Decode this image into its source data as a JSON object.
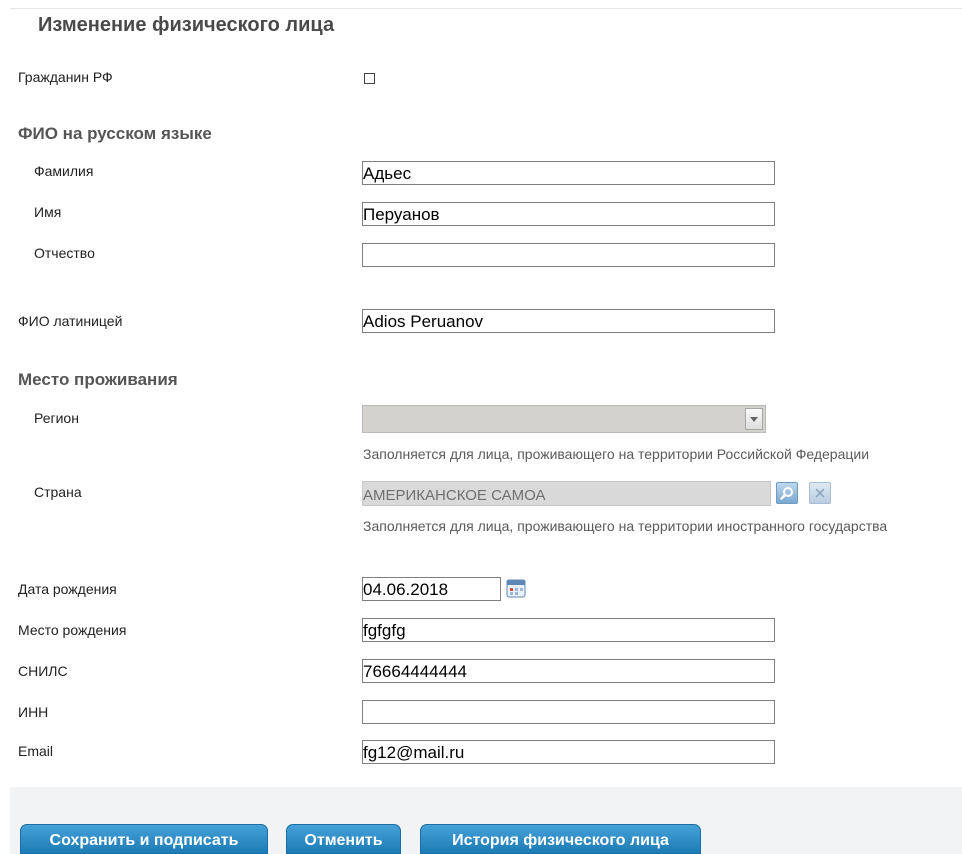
{
  "page": {
    "title": "Изменение физического лица"
  },
  "citizen": {
    "label": "Гражданин РФ",
    "checked": false
  },
  "fio_ru": {
    "section": "ФИО на русском языке",
    "surname": {
      "label": "Фамилия",
      "value": "Адьес"
    },
    "name": {
      "label": "Имя",
      "value": "Перуанов"
    },
    "patronymic": {
      "label": "Отчество",
      "value": ""
    }
  },
  "fio_lat": {
    "label": "ФИО латиницей",
    "value": "Adios Peruanov"
  },
  "residence": {
    "section": "Место проживания",
    "region": {
      "label": "Регион",
      "value": "",
      "hint": "Заполняется для лица, проживающего на территории Российской Федерации"
    },
    "country": {
      "label": "Страна",
      "value": "АМЕРИКАНСКОЕ САМОА",
      "hint": "Заполняется для лица, проживающего на территории иностранного государства"
    }
  },
  "birth_date": {
    "label": "Дата рождения",
    "value": "04.06.2018"
  },
  "birth_place": {
    "label": "Место рождения",
    "value": "fgfgfg"
  },
  "snils": {
    "label": "СНИЛС",
    "value": "76664444444"
  },
  "inn": {
    "label": "ИНН",
    "value": ""
  },
  "email": {
    "label": "Email",
    "value": "fg12@mail.ru"
  },
  "buttons": {
    "save": "Сохранить и подписать",
    "cancel": "Отменить",
    "history": "История физического лица"
  },
  "icons": {
    "checkbox": "checkbox-icon",
    "dropdown": "chevron-down-icon",
    "search": "search-icon",
    "clear": "close-icon",
    "calendar": "calendar-icon"
  },
  "colors": {
    "button": "#2389c4",
    "heading": "#4a4a4a",
    "readonly_field": "#d9d9d9"
  }
}
